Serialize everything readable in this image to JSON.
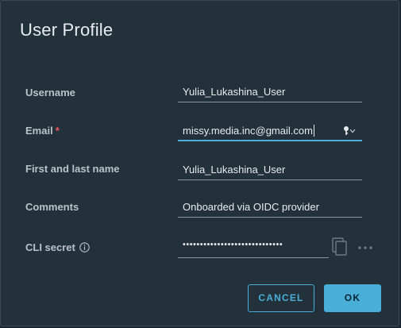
{
  "dialog": {
    "title": "User Profile"
  },
  "form": {
    "username": {
      "label": "Username",
      "value": "Yulia_Lukashina_User"
    },
    "email": {
      "label": "Email",
      "required_marker": "*",
      "value": "missy.media.inc@gmail.com"
    },
    "full_name": {
      "label": "First and last name",
      "value": "Yulia_Lukashina_User"
    },
    "comments": {
      "label": "Comments",
      "value": "Onboarded via OIDC provider"
    },
    "cli_secret": {
      "label": "CLI secret",
      "masked_value": "•••••••••••••••••••••••••••••"
    }
  },
  "buttons": {
    "cancel_label": "CANCEL",
    "ok_label": "OK"
  },
  "icons": {
    "info": "info-icon",
    "key_dropdown": "key-icon",
    "copy": "copy-icon",
    "more": "more-icon"
  },
  "colors": {
    "accent": "#49afd9",
    "required": "#f05a5a",
    "background": "#22313a",
    "text": "#e8ecef",
    "label": "#b9c4ca"
  }
}
